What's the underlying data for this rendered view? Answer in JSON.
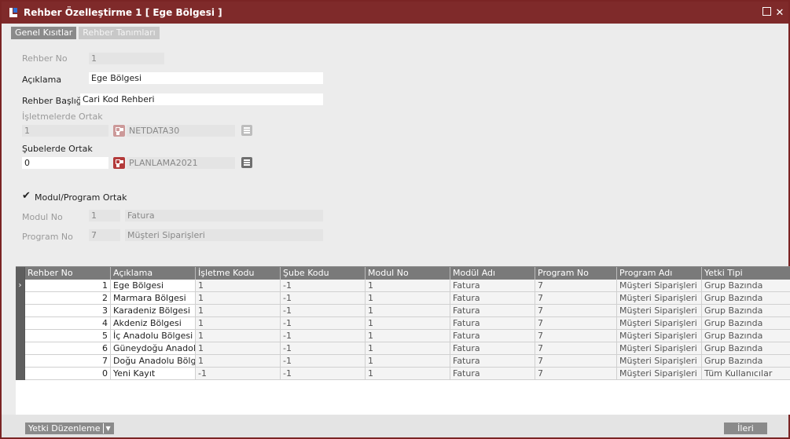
{
  "window": {
    "title": "Rehber Özelleştirme 1 [ Ege Bölgesi ]"
  },
  "tabs": [
    {
      "label": "Genel Kısıtlar",
      "active": true
    },
    {
      "label": "Rehber Tanımları",
      "active": false
    }
  ],
  "form": {
    "rehber_no_label": "Rehber No",
    "rehber_no_value": "1",
    "aciklama_label": "Açıklama",
    "aciklama_value": "Ege Bölgesi",
    "baslik_label": "Rehber Başlığı",
    "baslik_value": "Cari Kod Rehberi",
    "isletme_label": "İşletmelerde Ortak",
    "isletme_value": "1",
    "isletme_db": "NETDATA30",
    "sube_label": "Şubelerde Ortak",
    "sube_value": "0",
    "sube_db": "PLANLAMA2021",
    "modul_ortak_label": "Modul/Program Ortak",
    "modul_no_label": "Modul No",
    "modul_no_value": "1",
    "modul_name": "Fatura",
    "program_no_label": "Program No",
    "program_no_value": "7",
    "program_name": "Müşteri Siparişleri"
  },
  "grid": {
    "columns": [
      "Rehber No",
      "Açıklama",
      "İşletme Kodu",
      "Şube Kodu",
      "Modul No",
      "Modül Adı",
      "Program No",
      "Program Adı",
      "Yetki Tipi"
    ],
    "rows": [
      [
        "1",
        "Ege Bölgesi",
        "1",
        "-1",
        "1",
        "Fatura",
        "7",
        "Müşteri Siparişleri",
        "Grup Bazında"
      ],
      [
        "2",
        "Marmara Bölgesi",
        "1",
        "-1",
        "1",
        "Fatura",
        "7",
        "Müşteri Siparişleri",
        "Grup Bazında"
      ],
      [
        "3",
        "Karadeniz Bölgesi",
        "1",
        "-1",
        "1",
        "Fatura",
        "7",
        "Müşteri Siparişleri",
        "Grup Bazında"
      ],
      [
        "4",
        "Akdeniz Bölgesi",
        "1",
        "-1",
        "1",
        "Fatura",
        "7",
        "Müşteri Siparişleri",
        "Grup Bazında"
      ],
      [
        "5",
        "İç Anadolu Bölgesi",
        "1",
        "-1",
        "1",
        "Fatura",
        "7",
        "Müşteri Siparişleri",
        "Grup Bazında"
      ],
      [
        "6",
        "Güneydoğu Anadol",
        "1",
        "-1",
        "1",
        "Fatura",
        "7",
        "Müşteri Siparişleri",
        "Grup Bazında"
      ],
      [
        "7",
        "Doğu Anadolu Bölg",
        "1",
        "-1",
        "1",
        "Fatura",
        "7",
        "Müşteri Siparişleri",
        "Grup Bazında"
      ],
      [
        "0",
        "Yeni Kayıt",
        "-1",
        "-1",
        "1",
        "Fatura",
        "7",
        "Müşteri Siparişleri",
        "Tüm Kullanıcılar"
      ]
    ]
  },
  "footer": {
    "yetki_label": "Yetki Düzenleme",
    "ileri_label": "İleri"
  },
  "colors": {
    "titlebar": "#7f2a2a",
    "accent": "#b33a3a",
    "header": "#7a7a7a"
  }
}
